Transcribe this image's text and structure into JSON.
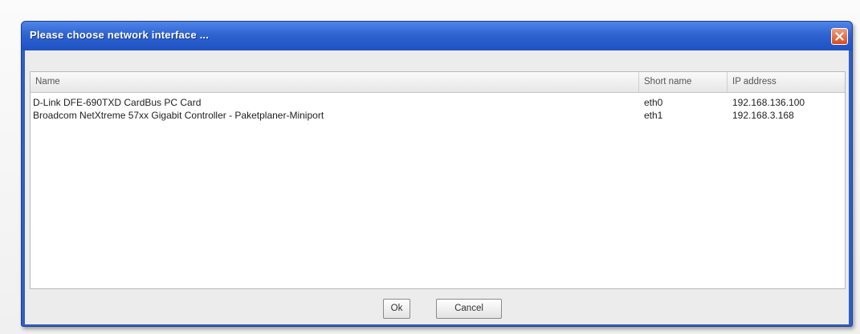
{
  "dialog": {
    "title": "Please choose network interface ...",
    "close_icon": "close-icon",
    "title_bar_color": "#2e63d1",
    "close_color": "#d64c20"
  },
  "table": {
    "headers": {
      "name": "Name",
      "short_name": "Short name",
      "ip_address": "IP address"
    },
    "rows": [
      {
        "name": "D-Link DFE-690TXD CardBus PC Card",
        "short_name": "eth0",
        "ip_address": "192.168.136.100"
      },
      {
        "name": "Broadcom NetXtreme 57xx Gigabit Controller - Paketplaner-Miniport",
        "short_name": "eth1",
        "ip_address": "192.168.3.168"
      }
    ]
  },
  "buttons": {
    "ok": "Ok",
    "cancel": "Cancel"
  }
}
